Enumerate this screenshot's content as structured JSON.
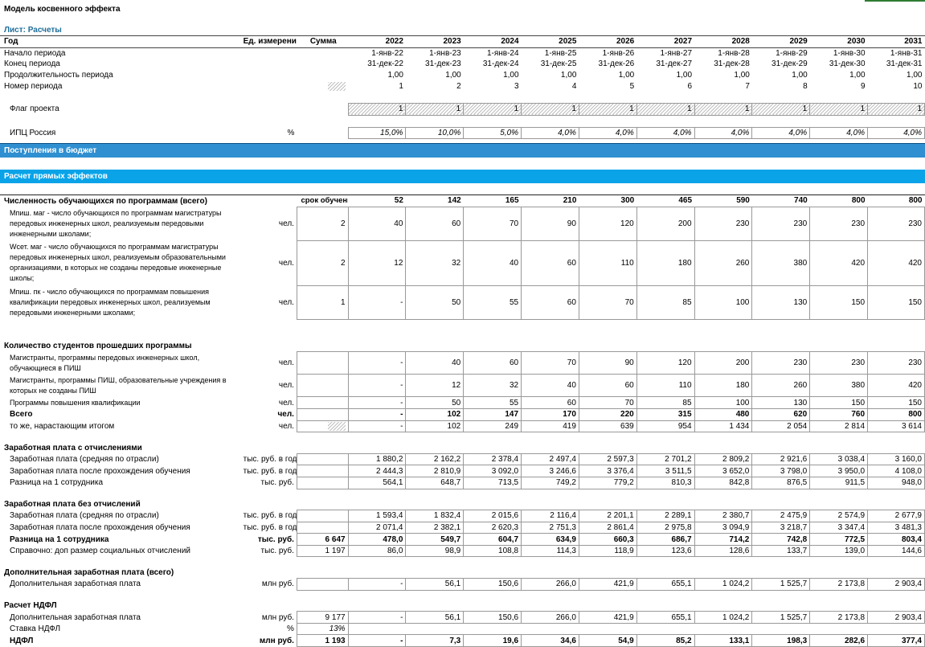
{
  "doc": {
    "title": "Модель косвенного эффекта",
    "sheet_label": "Лист: Расчеты"
  },
  "header": {
    "col_year": "Год",
    "col_unit": "Ед. измерения",
    "col_sum": "Сумма",
    "years": [
      "2022",
      "2023",
      "2024",
      "2025",
      "2026",
      "2027",
      "2028",
      "2029",
      "2030",
      "2031"
    ]
  },
  "period": {
    "start_label": "Начало периода",
    "start": [
      "1-янв-22",
      "1-янв-23",
      "1-янв-24",
      "1-янв-25",
      "1-янв-26",
      "1-янв-27",
      "1-янв-28",
      "1-янв-29",
      "1-янв-30",
      "1-янв-31"
    ],
    "end_label": "Конец периода",
    "end": [
      "31-дек-22",
      "31-дек-23",
      "31-дек-24",
      "31-дек-25",
      "31-дек-26",
      "31-дек-27",
      "31-дек-28",
      "31-дек-29",
      "31-дек-30",
      "31-дек-31"
    ],
    "duration_label": "Продолжительность периода",
    "duration": [
      "1,00",
      "1,00",
      "1,00",
      "1,00",
      "1,00",
      "1,00",
      "1,00",
      "1,00",
      "1,00",
      "1,00"
    ],
    "number_label": "Номер периода",
    "number": [
      "1",
      "2",
      "3",
      "4",
      "5",
      "6",
      "7",
      "8",
      "9",
      "10"
    ]
  },
  "flag": {
    "label": "Флаг проекта",
    "values": [
      "1",
      "1",
      "1",
      "1",
      "1",
      "1",
      "1",
      "1",
      "1",
      "1"
    ]
  },
  "cpi": {
    "label": "ИПЦ Россия",
    "unit": "%",
    "values": [
      "15,0%",
      "10,0%",
      "5,0%",
      "4,0%",
      "4,0%",
      "4,0%",
      "4,0%",
      "4,0%",
      "4,0%",
      "4,0%"
    ]
  },
  "sections": {
    "budget": "Поступления в бюджет",
    "direct": "Расчет прямых эффектов"
  },
  "students": {
    "label": "Численность обучающихся по программам (всего)",
    "term_label": "срок обучения, лет",
    "totals": [
      "52",
      "142",
      "165",
      "210",
      "300",
      "465",
      "590",
      "740",
      "800",
      "800"
    ],
    "rows": [
      {
        "label": "Мпиш. маг - число обучающихся по программам магистратуры передовых инженерных школ, реализуемым передовыми инженерными школами;",
        "unit": "чел.",
        "term": "2",
        "values": [
          "40",
          "60",
          "70",
          "90",
          "120",
          "200",
          "230",
          "230",
          "230",
          "230"
        ]
      },
      {
        "label": "Wсет. маг - число обучающихся по программам магистратуры передовых инженерных школ, реализуемым образовательными организациями, в которых не созданы передовые инженерные школы;",
        "unit": "чел.",
        "term": "2",
        "values": [
          "12",
          "32",
          "40",
          "60",
          "110",
          "180",
          "260",
          "380",
          "420",
          "420"
        ]
      },
      {
        "label": "Мпиш. пк - число обучающихся по программам повышения квалификации передовых инженерных школ, реализуемым передовыми инженерными школами;",
        "unit": "чел.",
        "term": "1",
        "values": [
          "-",
          "50",
          "55",
          "60",
          "70",
          "85",
          "100",
          "130",
          "150",
          "150"
        ]
      }
    ]
  },
  "graduates": {
    "label": "Количество студентов прошедших программы",
    "rows": [
      {
        "label": "Магистранты, программы передовых инженерных школ, обучающиеся в ПИШ",
        "unit": "чел.",
        "values": [
          "-",
          "40",
          "60",
          "70",
          "90",
          "120",
          "200",
          "230",
          "230",
          "230"
        ]
      },
      {
        "label": "Магистранты, программы ПИШ, образовательные учреждения в которых не созданы ПИШ",
        "unit": "чел.",
        "values": [
          "-",
          "12",
          "32",
          "40",
          "60",
          "110",
          "180",
          "260",
          "380",
          "420"
        ]
      },
      {
        "label": "Программы повышения квалификации",
        "unit": "чел.",
        "values": [
          "-",
          "50",
          "55",
          "60",
          "70",
          "85",
          "100",
          "130",
          "150",
          "150"
        ]
      }
    ],
    "total": {
      "label": "Всего",
      "unit": "чел.",
      "values": [
        "-",
        "102",
        "147",
        "170",
        "220",
        "315",
        "480",
        "620",
        "760",
        "800"
      ]
    },
    "cumulative": {
      "label": "то же, нарастающим итогом",
      "unit": "чел.",
      "values": [
        "-",
        "102",
        "249",
        "419",
        "639",
        "954",
        "1 434",
        "2 054",
        "2 814",
        "3 614"
      ]
    }
  },
  "salary_with": {
    "label": "Заработная плата с отчислениями",
    "rows": [
      {
        "label": "Заработная плата (средняя по отрасли)",
        "unit": "тыс. руб. в год",
        "values": [
          "1 880,2",
          "2 162,2",
          "2 378,4",
          "2 497,4",
          "2 597,3",
          "2 701,2",
          "2 809,2",
          "2 921,6",
          "3 038,4",
          "3 160,0"
        ]
      },
      {
        "label": "Заработная плата после прохождения обучения",
        "unit": "тыс. руб. в год",
        "values": [
          "2 444,3",
          "2 810,9",
          "3 092,0",
          "3 246,6",
          "3 376,4",
          "3 511,5",
          "3 652,0",
          "3 798,0",
          "3 950,0",
          "4 108,0"
        ]
      },
      {
        "label": "Разница на 1 сотрудника",
        "unit": "тыс. руб.",
        "values": [
          "564,1",
          "648,7",
          "713,5",
          "749,2",
          "779,2",
          "810,3",
          "842,8",
          "876,5",
          "911,5",
          "948,0"
        ]
      }
    ]
  },
  "salary_without": {
    "label": "Заработная плата без отчислений",
    "rows": [
      {
        "label": "Заработная плата (средняя по отрасли)",
        "unit": "тыс. руб. в год",
        "sum": "",
        "values": [
          "1 593,4",
          "1 832,4",
          "2 015,6",
          "2 116,4",
          "2 201,1",
          "2 289,1",
          "2 380,7",
          "2 475,9",
          "2 574,9",
          "2 677,9"
        ]
      },
      {
        "label": "Заработная плата после прохождения обучения",
        "unit": "тыс. руб. в год",
        "sum": "",
        "values": [
          "2 071,4",
          "2 382,1",
          "2 620,3",
          "2 751,3",
          "2 861,4",
          "2 975,8",
          "3 094,9",
          "3 218,7",
          "3 347,4",
          "3 481,3"
        ]
      },
      {
        "label": "Разница на 1 сотрудника",
        "unit": "тыс. руб.",
        "sum": "6 647",
        "values": [
          "478,0",
          "549,7",
          "604,7",
          "634,9",
          "660,3",
          "686,7",
          "714,2",
          "742,8",
          "772,5",
          "803,4"
        ]
      },
      {
        "label": "Справочно: доп размер социальных отчислений",
        "unit": "тыс. руб.",
        "sum": "1 197",
        "values": [
          "86,0",
          "98,9",
          "108,8",
          "114,3",
          "118,9",
          "123,6",
          "128,6",
          "133,7",
          "139,0",
          "144,6"
        ]
      }
    ]
  },
  "extra_salary": {
    "label": "Дополнительная заработная плата (всего)",
    "row": {
      "label": "Дополнительная заработная плата",
      "unit": "млн руб.",
      "values": [
        "-",
        "56,1",
        "150,6",
        "266,0",
        "421,9",
        "655,1",
        "1 024,2",
        "1 525,7",
        "2 173,8",
        "2 903,4"
      ]
    }
  },
  "ndfl": {
    "label": "Расчет НДФЛ",
    "rows": [
      {
        "label": "Дополнительная заработная плата",
        "unit": "млн руб.",
        "sum": "9 177",
        "values": [
          "-",
          "56,1",
          "150,6",
          "266,0",
          "421,9",
          "655,1",
          "1 024,2",
          "1 525,7",
          "2 173,8",
          "2 903,4"
        ]
      },
      {
        "label": "Ставка НДФЛ",
        "unit": "%",
        "sum": "13%",
        "values": [
          "",
          "",
          "",
          "",
          "",
          "",
          "",
          "",
          "",
          ""
        ]
      },
      {
        "label": "НДФЛ",
        "unit": "млн руб.",
        "sum": "1 193",
        "values": [
          "-",
          "7,3",
          "19,6",
          "34,6",
          "54,9",
          "85,2",
          "133,1",
          "198,3",
          "282,6",
          "377,4"
        ]
      }
    ]
  }
}
